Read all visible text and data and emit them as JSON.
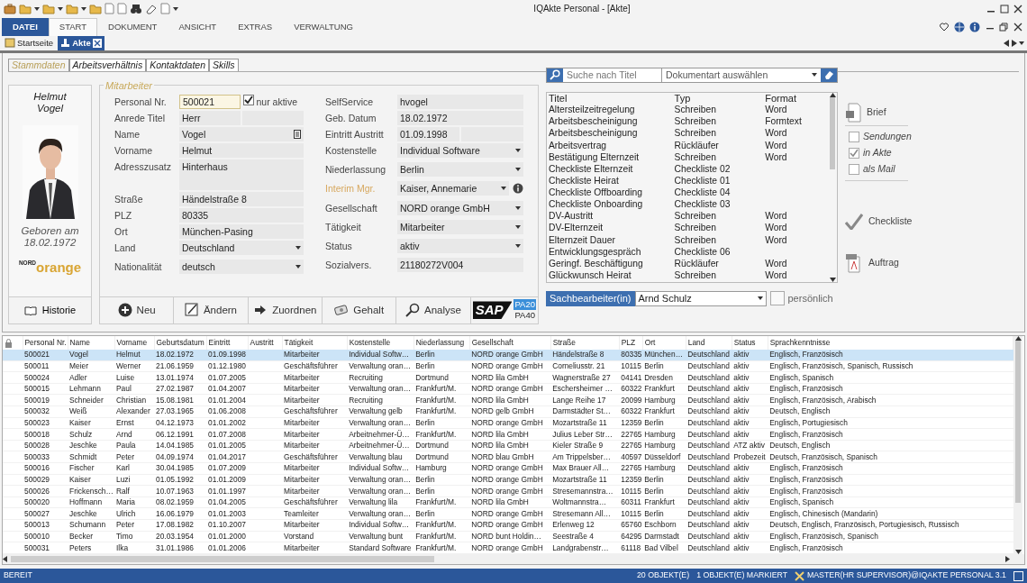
{
  "window": {
    "title": "IQAkte Personal - [Akte]"
  },
  "ribbon_tabs": [
    {
      "label": "DATEI",
      "kind": "file",
      "selected": false
    },
    {
      "label": "START",
      "kind": "tab",
      "selected": true
    },
    {
      "label": "DOKUMENT",
      "kind": "tab",
      "selected": false
    },
    {
      "label": "ANSICHT",
      "kind": "tab",
      "selected": false
    },
    {
      "label": "EXTRAS",
      "kind": "tab",
      "selected": false
    },
    {
      "label": "VERWALTUNG",
      "kind": "tab",
      "selected": false
    }
  ],
  "doc_tabs": [
    {
      "label": "Startseite",
      "selected": false
    },
    {
      "label": "Akte",
      "selected": true
    }
  ],
  "sub_tabs": [
    {
      "label": "Stammdaten",
      "selected": true
    },
    {
      "label": "Arbeitsverhältnis",
      "selected": false
    },
    {
      "label": "Kontaktdaten",
      "selected": false
    },
    {
      "label": "Skills",
      "selected": false
    }
  ],
  "profile": {
    "name_lines": [
      "Helmut",
      "Vogel"
    ],
    "birth_lines": [
      "Geboren am",
      "18.02.1972"
    ],
    "logo": {
      "small": "NORD",
      "large": "orange"
    },
    "history_button": "Historie"
  },
  "employee_form": {
    "title": "Mitarbeiter",
    "left_fields": [
      {
        "label": "Personal Nr.",
        "value": "500021",
        "kind": "id",
        "check": {
          "label": "nur aktive",
          "checked": true
        }
      },
      {
        "label": "Anrede Titel",
        "value": "Herr",
        "kind": "split"
      },
      {
        "label": "Name",
        "value": "Vogel",
        "kind": "note"
      },
      {
        "label": "Vorname",
        "value": "Helmut",
        "kind": "text"
      },
      {
        "label": "Adresszusatz",
        "value": "Hinterhaus",
        "kind": "multiline"
      },
      {
        "label": "Straße",
        "value": "Händelstraße 8",
        "kind": "text"
      },
      {
        "label": "PLZ",
        "value": "80335",
        "kind": "text"
      },
      {
        "label": "Ort",
        "value": "München-Pasing",
        "kind": "text"
      },
      {
        "label": "Land",
        "value": "Deutschland",
        "kind": "dropdown"
      },
      {
        "label": "Nationalität",
        "value": "deutsch",
        "kind": "dropdown"
      }
    ],
    "right_fields": [
      {
        "label": "SelfService",
        "value": "hvogel",
        "kind": "text"
      },
      {
        "label": "Geb. Datum",
        "value": "18.02.1972",
        "kind": "text"
      },
      {
        "label": "Eintritt Austritt",
        "value": "01.09.1998",
        "kind": "split"
      },
      {
        "label": "Kostenstelle",
        "value": "Individual Software",
        "kind": "dropdown"
      },
      {
        "label": "Niederlassung",
        "value": "Berlin",
        "kind": "dropdown"
      },
      {
        "label": "Interim Mgr.",
        "value": "Kaiser, Annemarie",
        "kind": "lookup"
      },
      {
        "label": "Gesellschaft",
        "value": "NORD orange GmbH",
        "kind": "dropdown"
      },
      {
        "label": "Tätigkeit",
        "value": "Mitarbeiter",
        "kind": "dropdown"
      },
      {
        "label": "Status",
        "value": "aktiv",
        "kind": "dropdown"
      },
      {
        "label": "Sozialvers.",
        "value": "21180272V004",
        "kind": "text"
      }
    ]
  },
  "actions": [
    {
      "label": "Neu",
      "kind": "new"
    },
    {
      "label": "Ändern",
      "kind": "edit"
    },
    {
      "label": "Zuordnen",
      "kind": "assign"
    },
    {
      "label": "Gehalt",
      "kind": "salary"
    },
    {
      "label": "Analyse",
      "kind": "analyse"
    }
  ],
  "sap": {
    "logo": "SAP",
    "versions": [
      {
        "label": "PA20",
        "selected": true
      },
      {
        "label": "PA40",
        "selected": false
      }
    ]
  },
  "documents": {
    "search_placeholder": "Suche nach Titel",
    "type_placeholder": "Dokumentart auswählen",
    "columns": [
      "Titel",
      "Typ",
      "Format"
    ],
    "rows": [
      [
        "Altersteilzeitregelung",
        "Schreiben",
        "Word"
      ],
      [
        "Arbeitsbescheinigung",
        "Schreiben",
        "Formtext"
      ],
      [
        "Arbeitsbescheinigung",
        "Schreiben",
        "Word"
      ],
      [
        "Arbeitsvertrag",
        "Rückläufer",
        "Word"
      ],
      [
        "Bestätigung Elternzeit",
        "Schreiben",
        "Word"
      ],
      [
        "Checkliste Elternzeit",
        "Checkliste 02",
        null
      ],
      [
        "Checkliste Heirat",
        "Checkliste 01",
        null
      ],
      [
        "Checkliste Offboarding",
        "Checkliste 04",
        null
      ],
      [
        "Checkliste Onboarding",
        "Checkliste 03",
        null
      ],
      [
        "DV-Austritt",
        "Schreiben",
        "Word"
      ],
      [
        "DV-Elternzeit",
        "Schreiben",
        "Word"
      ],
      [
        "Elternzeit Dauer",
        "Schreiben",
        "Word"
      ],
      [
        "Entwicklungsgespräch",
        "Checkliste 06",
        null
      ],
      [
        "Geringf. Beschäftigung",
        "Rückläufer",
        "Word"
      ],
      [
        "Glückwunsch Heirat",
        "Schreiben",
        "Word"
      ]
    ],
    "clerk": {
      "label": "Sachbearbeiter(in)",
      "value": "Arnd Schulz",
      "personal": {
        "label": "persönlich",
        "checked": false
      }
    }
  },
  "doc_actions": [
    {
      "kind": "letter",
      "label": "Brief"
    },
    {
      "kind": "option",
      "label": "Sendungen",
      "checked": false
    },
    {
      "kind": "option",
      "label": "in Akte",
      "checked": true
    },
    {
      "kind": "option",
      "label": "als Mail",
      "checked": false
    },
    {
      "kind": "checklist",
      "label": "Checkliste"
    },
    {
      "kind": "pdf",
      "label": "Auftrag"
    }
  ],
  "employees": {
    "columns": [
      "Personal Nr.",
      "Name",
      "Vorname",
      "Geburtsdatum",
      "Eintritt",
      "Austritt",
      "Tätigkeit",
      "Kostenstelle",
      "Niederlassung",
      "Gesellschaft",
      "Straße",
      "PLZ",
      "Ort",
      "Land",
      "Status",
      "Sprachkenntnisse"
    ],
    "rows": [
      {
        "selected": true,
        "cells": [
          "500021",
          "Vogel",
          "Helmut",
          "18.02.1972",
          "01.09.1998",
          null,
          "Mitarbeiter",
          "Individual Softw…",
          "Berlin",
          "NORD orange GmbH",
          "Händelstraße 8",
          "80335",
          "München…",
          "Deutschland",
          "aktiv",
          "Englisch, Französisch"
        ]
      },
      {
        "selected": false,
        "cells": [
          "500011",
          "Meier",
          "Werner",
          "21.06.1959",
          "01.12.1980",
          null,
          "Geschäftsführer",
          "Verwaltung oran…",
          "Berlin",
          "NORD orange GmbH",
          "Corneliusstr. 21",
          "10115",
          "Berlin",
          "Deutschland",
          "aktiv",
          "Englisch, Französisch, Spanisch, Russisch"
        ]
      },
      {
        "selected": false,
        "cells": [
          "500024",
          "Adler",
          "Luise",
          "13.01.1974",
          "01.07.2005",
          null,
          "Mitarbeiter",
          "Recruiting",
          "Dortmund",
          "NORD lila GmbH",
          "Wagnerstraße 27",
          "04141",
          "Dresden",
          "Deutschland",
          "aktiv",
          "Englisch, Spanisch"
        ]
      },
      {
        "selected": false,
        "cells": [
          "500015",
          "Lehmann",
          "Paul",
          "27.02.1987",
          "01.04.2007",
          null,
          "Mitarbeiter",
          "Verwaltung oran…",
          "Frankfurt/M.",
          "NORD orange GmbH",
          "Eschersheimer …",
          "60322",
          "Frankfurt",
          "Deutschland",
          "aktiv",
          "Englisch, Französisch"
        ]
      },
      {
        "selected": false,
        "cells": [
          "500019",
          "Schneider",
          "Christian",
          "15.08.1981",
          "01.01.2004",
          null,
          "Mitarbeiter",
          "Recruiting",
          "Frankfurt/M.",
          "NORD lila GmbH",
          "Lange Reihe 17",
          "20099",
          "Hamburg",
          "Deutschland",
          "aktiv",
          "Englisch, Französisch, Arabisch"
        ]
      },
      {
        "selected": false,
        "cells": [
          "500032",
          "Weiß",
          "Alexander",
          "27.03.1965",
          "01.06.2008",
          null,
          "Geschäftsführer",
          "Verwaltung gelb",
          "Frankfurt/M.",
          "NORD gelb GmbH",
          "Darmstädter St…",
          "60322",
          "Frankfurt",
          "Deutschland",
          "aktiv",
          "Deutsch, Englisch"
        ]
      },
      {
        "selected": false,
        "cells": [
          "500023",
          "Kaiser",
          "Ernst",
          "04.12.1973",
          "01.01.2002",
          null,
          "Mitarbeiter",
          "Verwaltung oran…",
          "Berlin",
          "NORD orange GmbH",
          "Mozartstraße 11",
          "12359",
          "Berlin",
          "Deutschland",
          "aktiv",
          "Englisch, Portugiesisch"
        ]
      },
      {
        "selected": false,
        "cells": [
          "500018",
          "Schulz",
          "Arnd",
          "06.12.1991",
          "01.07.2008",
          null,
          "Mitarbeiter",
          "Arbeitnehmer-Ü…",
          "Frankfurt/M.",
          "NORD lila GmbH",
          "Julius Leber Str…",
          "22765",
          "Hamburg",
          "Deutschland",
          "aktiv",
          "Englisch, Französisch"
        ]
      },
      {
        "selected": false,
        "cells": [
          "500028",
          "Jeschke",
          "Paula",
          "14.04.1985",
          "01.01.2005",
          null,
          "Mitarbeiter",
          "Arbeitnehmer-Ü…",
          "Dortmund",
          "NORD lila GmbH",
          "Kieler Straße 9",
          "22765",
          "Hamburg",
          "Deutschland",
          "ATZ aktiv",
          "Deutsch, Englisch"
        ]
      },
      {
        "selected": false,
        "cells": [
          "500033",
          "Schmidt",
          "Peter",
          "04.09.1974",
          "01.04.2017",
          null,
          "Geschäftsführer",
          "Verwaltung blau",
          "Dortmund",
          "NORD blau GmbH",
          "Am Trippelsber…",
          "40597",
          "Düsseldorf",
          "Deutschland",
          "Probezeit",
          "Deutsch, Französisch, Spanisch"
        ]
      },
      {
        "selected": false,
        "cells": [
          "500016",
          "Fischer",
          "Karl",
          "30.04.1985",
          "01.07.2009",
          null,
          "Mitarbeiter",
          "Individual Softw…",
          "Hamburg",
          "NORD orange GmbH",
          "Max Brauer All…",
          "22765",
          "Hamburg",
          "Deutschland",
          "aktiv",
          "Englisch, Französisch"
        ]
      },
      {
        "selected": false,
        "cells": [
          "500029",
          "Kaiser",
          "Luzi",
          "01.05.1992",
          "01.01.2009",
          null,
          "Mitarbeiter",
          "Verwaltung oran…",
          "Berlin",
          "NORD orange GmbH",
          "Mozartstraße 11",
          "12359",
          "Berlin",
          "Deutschland",
          "aktiv",
          "Englisch, Französisch"
        ]
      },
      {
        "selected": false,
        "cells": [
          "500026",
          "Frickensch…",
          "Ralf",
          "10.07.1963",
          "01.01.1997",
          null,
          "Mitarbeiter",
          "Verwaltung oran…",
          "Berlin",
          "NORD orange GmbH",
          "Stresemannstra…",
          "10115",
          "Berlin",
          "Deutschland",
          "aktiv",
          "Englisch, Französisch"
        ]
      },
      {
        "selected": false,
        "cells": [
          "500020",
          "Hoffmann",
          "Maria",
          "08.02.1959",
          "01.04.2005",
          null,
          "Geschäftsführer",
          "Verwaltung lila",
          "Frankfurt/M.",
          "NORD lila GmbH",
          "Woltmannstra…",
          "60311",
          "Frankfurt",
          "Deutschland",
          "aktiv",
          "Englisch, Spanisch"
        ]
      },
      {
        "selected": false,
        "cells": [
          "500027",
          "Jeschke",
          "Ulrich",
          "16.06.1979",
          "01.01.2003",
          null,
          "Teamleiter",
          "Verwaltung oran…",
          "Berlin",
          "NORD orange GmbH",
          "Stresemann All…",
          "10115",
          "Berlin",
          "Deutschland",
          "aktiv",
          "Englisch, Chinesisch (Mandarin)"
        ]
      },
      {
        "selected": false,
        "cells": [
          "500013",
          "Schumann",
          "Peter",
          "17.08.1982",
          "01.10.2007",
          null,
          "Mitarbeiter",
          "Individual Softw…",
          "Frankfurt/M.",
          "NORD orange GmbH",
          "Erlenweg 12",
          "65760",
          "Eschborn",
          "Deutschland",
          "aktiv",
          "Deutsch, Englisch, Französisch, Portugiesisch, Russisch"
        ]
      },
      {
        "selected": false,
        "cells": [
          "500010",
          "Becker",
          "Timo",
          "20.03.1954",
          "01.01.2000",
          null,
          "Vorstand",
          "Verwaltung bunt",
          "Frankfurt/M.",
          "NORD bunt Holdin…",
          "Seestraße 4",
          "64295",
          "Darmstadt",
          "Deutschland",
          "aktiv",
          "Englisch, Französisch, Spanisch"
        ]
      },
      {
        "selected": false,
        "cells": [
          "500031",
          "Peters",
          "Ilka",
          "31.01.1986",
          "01.01.2006",
          null,
          "Mitarbeiter",
          "Standard Software",
          "Frankfurt/M.",
          "NORD orange GmbH",
          "Landgrabenstr…",
          "61118",
          "Bad Vilbel",
          "Deutschland",
          "aktiv",
          "Englisch, Französisch"
        ]
      }
    ]
  },
  "status_bar": {
    "state": "BEREIT",
    "count": "20 OBJEKT(E)",
    "marked": "1 OBJEKT(E) MARKIERT",
    "user": "MASTER(HR SUPERVISOR)@IQAKTE PERSONAL 3.1"
  }
}
